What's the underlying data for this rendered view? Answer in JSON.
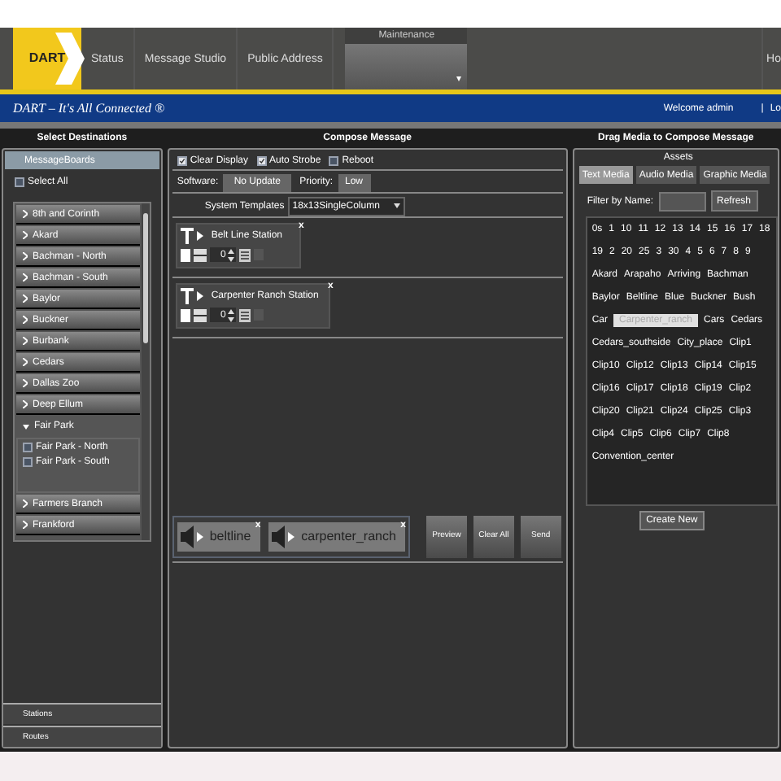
{
  "header": {
    "logo": "DART",
    "nav": [
      {
        "label": "Status",
        "selected": false
      },
      {
        "label": "Message Studio",
        "selected": false
      },
      {
        "label": "Public Address",
        "selected": false
      }
    ],
    "maintenance": {
      "label": "Maintenance",
      "arrow": "▾"
    },
    "nav_right": "Ho"
  },
  "banner": {
    "title": "DART – It's All Connected ®",
    "welcome": "Welcome admin",
    "separator": "|",
    "logout": "Lo"
  },
  "destinations": {
    "title": "Select Destinations",
    "accordion": "MessageBoards",
    "select_all": {
      "label": "Select All",
      "checked": false
    },
    "groups": [
      {
        "label": "8th and Corinth",
        "expanded": false
      },
      {
        "label": "Akard",
        "expanded": false
      },
      {
        "label": "Bachman - North",
        "expanded": false
      },
      {
        "label": "Bachman - South",
        "expanded": false
      },
      {
        "label": "Baylor",
        "expanded": false
      },
      {
        "label": "Buckner",
        "expanded": false
      },
      {
        "label": "Burbank",
        "expanded": false
      },
      {
        "label": "Cedars",
        "expanded": false
      },
      {
        "label": "Dallas Zoo",
        "expanded": false
      },
      {
        "label": "Deep Ellum",
        "expanded": false
      },
      {
        "label": "Fair Park",
        "expanded": true,
        "children": [
          {
            "label": "Fair Park - North",
            "checked": false
          },
          {
            "label": "Fair Park - South",
            "checked": false
          }
        ]
      },
      {
        "label": "Farmers Branch",
        "expanded": false
      },
      {
        "label": "Frankford",
        "expanded": false
      }
    ],
    "sections": [
      "Stations",
      "Routes"
    ]
  },
  "compose": {
    "title": "Compose Message",
    "options": [
      {
        "label": "Clear Display",
        "checked": true
      },
      {
        "label": "Auto Strobe",
        "checked": true
      },
      {
        "label": "Reboot",
        "checked": false
      }
    ],
    "software_label": "Software:",
    "software": "No Update",
    "priority_label": "Priority:",
    "priority": "Low",
    "templates_label": "System Templates",
    "template": "18x13SingleColumn",
    "messages": [
      {
        "text": "Belt Line Station",
        "count": "0",
        "close": "x"
      },
      {
        "text": "Carpenter Ranch Station",
        "count": "0",
        "close": "x"
      }
    ],
    "audio": [
      {
        "label": "beltline",
        "close": "x"
      },
      {
        "label": "carpenter_ranch",
        "close": "x"
      }
    ],
    "buttons": [
      "Preview",
      "Clear All",
      "Send"
    ]
  },
  "media": {
    "title": "Drag Media to Compose Message",
    "assets_title": "Assets",
    "tabs": [
      {
        "label": "Text Media",
        "selected": true
      },
      {
        "label": "Audio Media",
        "selected": false
      },
      {
        "label": "Graphic Media",
        "selected": false
      }
    ],
    "filter_label": "Filter by Name:",
    "refresh": "Refresh",
    "assets": [
      {
        "label": "0s",
        "selected": false
      },
      {
        "label": "1",
        "selected": false
      },
      {
        "label": "10",
        "selected": false
      },
      {
        "label": "11",
        "selected": false
      },
      {
        "label": "12",
        "selected": false
      },
      {
        "label": "13",
        "selected": false
      },
      {
        "label": "14",
        "selected": false
      },
      {
        "label": "15",
        "selected": false
      },
      {
        "label": "16",
        "selected": false
      },
      {
        "label": "17",
        "selected": false
      },
      {
        "label": "18",
        "selected": false
      },
      {
        "label": "19",
        "selected": false
      },
      {
        "label": "2",
        "selected": false
      },
      {
        "label": "20",
        "selected": false
      },
      {
        "label": "25",
        "selected": false
      },
      {
        "label": "3",
        "selected": false
      },
      {
        "label": "30",
        "selected": false
      },
      {
        "label": "4",
        "selected": false
      },
      {
        "label": "5",
        "selected": false
      },
      {
        "label": "6",
        "selected": false
      },
      {
        "label": "7",
        "selected": false
      },
      {
        "label": "8",
        "selected": false
      },
      {
        "label": "9",
        "selected": false
      },
      {
        "label": "Akard",
        "selected": false
      },
      {
        "label": "Arapaho",
        "selected": false
      },
      {
        "label": "Arriving",
        "selected": false
      },
      {
        "label": "Bachman",
        "selected": false
      },
      {
        "label": "Baylor",
        "selected": false
      },
      {
        "label": "Beltline",
        "selected": false
      },
      {
        "label": "Blue",
        "selected": false
      },
      {
        "label": "Buckner",
        "selected": false
      },
      {
        "label": "Bush",
        "selected": false
      },
      {
        "label": "Car",
        "selected": false
      },
      {
        "label": "Carpenter_ranch",
        "selected": true
      },
      {
        "label": "Cars",
        "selected": false
      },
      {
        "label": "Cedars",
        "selected": false
      },
      {
        "label": "Cedars_southside",
        "selected": false
      },
      {
        "label": "City_place",
        "selected": false
      },
      {
        "label": "Clip1",
        "selected": false
      },
      {
        "label": "Clip10",
        "selected": false
      },
      {
        "label": "Clip12",
        "selected": false
      },
      {
        "label": "Clip13",
        "selected": false
      },
      {
        "label": "Clip14",
        "selected": false
      },
      {
        "label": "Clip15",
        "selected": false
      },
      {
        "label": "Clip16",
        "selected": false
      },
      {
        "label": "Clip17",
        "selected": false
      },
      {
        "label": "Clip18",
        "selected": false
      },
      {
        "label": "Clip19",
        "selected": false
      },
      {
        "label": "Clip2",
        "selected": false
      },
      {
        "label": "Clip20",
        "selected": false
      },
      {
        "label": "Clip21",
        "selected": false
      },
      {
        "label": "Clip24",
        "selected": false
      },
      {
        "label": "Clip25",
        "selected": false
      },
      {
        "label": "Clip3",
        "selected": false
      },
      {
        "label": "Clip4",
        "selected": false
      },
      {
        "label": "Clip5",
        "selected": false
      },
      {
        "label": "Clip6",
        "selected": false
      },
      {
        "label": "Clip7",
        "selected": false
      },
      {
        "label": "Clip8",
        "selected": false
      },
      {
        "label": "Convention_center",
        "selected": false
      }
    ],
    "create": "Create New"
  }
}
